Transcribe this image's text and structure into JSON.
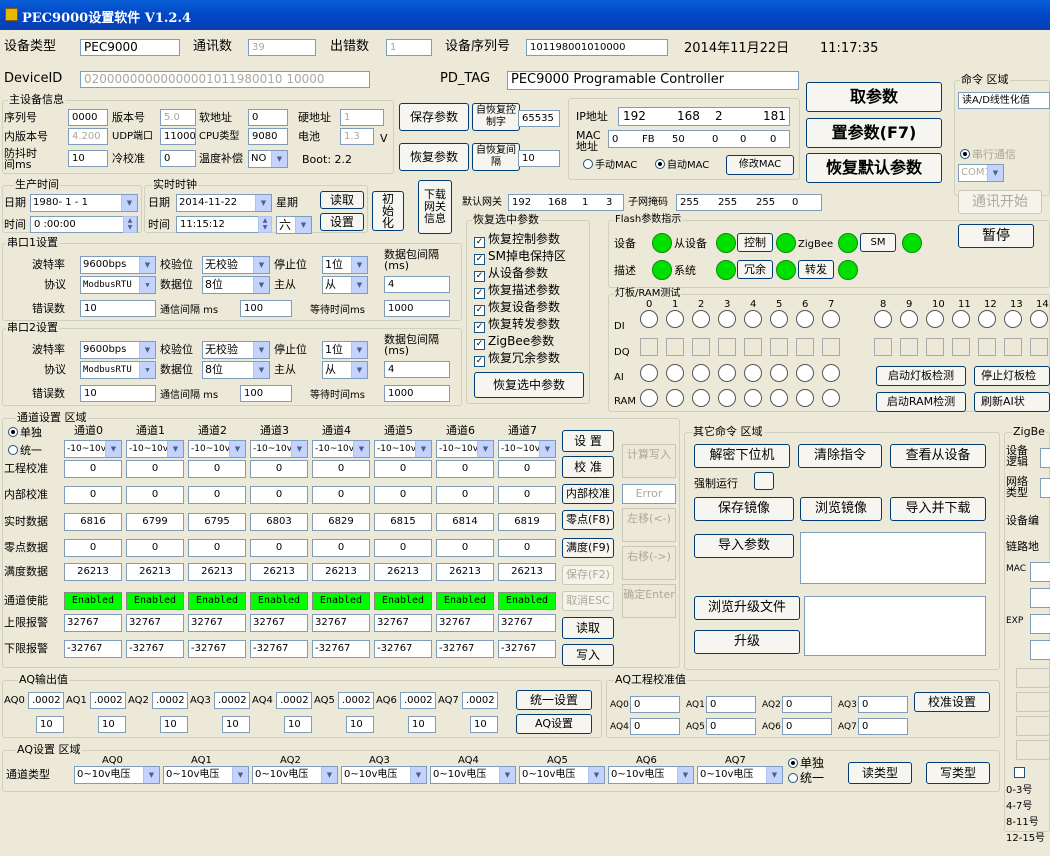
{
  "title": "PEC9000设置软件 V1.2.4",
  "top": {
    "devtype_label": "设备类型",
    "devtype": "PEC9000",
    "comm_label": "通讯数",
    "comm": "39",
    "err_label": "出错数",
    "err": "1",
    "serial_label": "设备序列号",
    "serial": "101198001010000",
    "date": "2014年11月22日",
    "time": "11:17:35",
    "devid_label": "DeviceID",
    "devid": "02000000000000001011980010 10000",
    "pdtag_label": "PD_TAG",
    "pdtag": "PEC9000 Programable Controller"
  },
  "master": {
    "title": "主设备信息",
    "seq_l": "序列号",
    "seq": "0000",
    "ver_l": "版本号",
    "ver": "5.0",
    "soft_l": "软地址",
    "soft": "0",
    "hard_l": "硬地址",
    "hard": "1",
    "inner_l": "内版本号",
    "inner": "4.200",
    "udp_l": "UDP端口",
    "udp": "11000",
    "cpu_l": "CPU类型",
    "cpu": "9080",
    "bat_l": "电池",
    "bat": "1.3",
    "v": "V",
    "shake_l": "防抖时间ms",
    "shake": "10",
    "cold_l": "冷校准",
    "cold": "0",
    "temp_l": "温度补偿",
    "temp": "NO",
    "boot": "Boot: 2.2"
  },
  "btns": {
    "save": "保存参数",
    "restore": "恢复参数",
    "auto_ctrl": "自恢复控制字",
    "auto_ctrl_v": "65535",
    "auto_int": "自恢复间隔",
    "auto_int_v": "10",
    "get": "取参数",
    "set": "置参数(F7)",
    "default": "恢复默认参数",
    "comm_start": "通讯开始",
    "pause": "暂停",
    "read": "读取",
    "setting": "设置",
    "init": "初始化",
    "gwinfo": "下载网关信息",
    "restore_sel": "恢复选中参数"
  },
  "ip": {
    "ip_l": "IP地址",
    "ip": [
      "192",
      "168",
      "2",
      "181"
    ],
    "mac_l": "MAC地址",
    "mac": [
      "0",
      "FB",
      "50",
      "0",
      "0",
      "0"
    ],
    "manual": "手动MAC",
    "auto": "自动MAC",
    "modmac": "修改MAC",
    "gw_l": "默认网关",
    "gw": [
      "192",
      "168",
      "1",
      "3"
    ],
    "mask_l": "子网掩码",
    "mask": [
      "255",
      "255",
      "255",
      "0"
    ]
  },
  "cmd": {
    "title": "命令 区域",
    "value": "读A/D线性化值",
    "serial": "串行通信",
    "com": "COM1"
  },
  "prod": {
    "title": "生产时间",
    "date_l": "日期",
    "date": "1980- 1 - 1",
    "time_l": "时间",
    "time": "0 :00:00"
  },
  "rtc": {
    "title": "实时时钟",
    "date_l": "日期",
    "date": "2014-11-22",
    "week_l": "星期",
    "week": "六",
    "time_l": "时间",
    "time": "11:15:12"
  },
  "com1": {
    "title": "串口1设置",
    "baud_l": "波特率",
    "baud": "9600bps",
    "parity_l": "校验位",
    "parity": "无校验",
    "stop_l": "停止位",
    "stop": "1位",
    "gap_l": "数据包间隔(ms)",
    "proto_l": "协议",
    "proto": "ModbusRTU",
    "data_l": "数据位",
    "data": "8位",
    "master_l": "主从",
    "master": "从",
    "gap": "4",
    "err_l": "错误数",
    "err": "10",
    "comm_l": "通信间隔 ms",
    "comm": "100",
    "wait_l": "等待时间ms",
    "wait": "1000"
  },
  "com2": {
    "title": "串口2设置",
    "baud_l": "波特率",
    "baud": "9600bps",
    "parity_l": "校验位",
    "parity": "无校验",
    "stop_l": "停止位",
    "stop": "1位",
    "gap_l": "数据包间隔(ms)",
    "proto_l": "协议",
    "proto": "ModbusRTU",
    "data_l": "数据位",
    "data": "8位",
    "master_l": "主从",
    "master": "从",
    "gap": "4",
    "err_l": "错误数",
    "err": "10",
    "comm_l": "通信间隔 ms",
    "comm": "100",
    "wait_l": "等待时间ms",
    "wait": "1000"
  },
  "restore": {
    "title": "恢复选中参数",
    "items": [
      "恢复控制参数",
      "SM掉电保持区",
      "从设备参数",
      "恢复描述参数",
      "恢复设备参数",
      "恢复转发参数",
      "ZigBee参数",
      "恢复冗余参数"
    ]
  },
  "flash": {
    "title": "Flash参数指示",
    "dev_l": "设备",
    "slave": "从设备",
    "ctrl": "控制",
    "zigbee": "ZigBee",
    "sm": "SM",
    "desc_l": "描述",
    "sys": "系统",
    "redun": "冗余",
    "fwd": "转发"
  },
  "lamp": {
    "title": "灯板/RAM测试",
    "di": "DI",
    "dq": "DQ",
    "ai": "AI",
    "ram": "RAM",
    "nums": [
      "0",
      "1",
      "2",
      "3",
      "4",
      "5",
      "6",
      "7",
      "8",
      "9",
      "10",
      "11",
      "12",
      "13",
      "14"
    ],
    "start_lamp": "启动灯板检测",
    "stop_lamp": "停止灯板检",
    "start_ram": "启动RAM检测",
    "refresh_ai": "刷新AI状"
  },
  "chan": {
    "title": "通道设置 区域",
    "single": "单独",
    "unify": "统一",
    "names": [
      "通道0",
      "通道1",
      "通道2",
      "通道3",
      "通道4",
      "通道5",
      "通道6",
      "通道7"
    ],
    "range": "-10~10v",
    "rows": [
      "工程校准",
      "内部校准",
      "实时数据",
      "零点数据",
      "满度数据",
      "通道使能",
      "上限报警",
      "下限报警"
    ],
    "eng": [
      "0",
      "0",
      "0",
      "0",
      "0",
      "0",
      "0",
      "0"
    ],
    "inner": [
      "0",
      "0",
      "0",
      "0",
      "0",
      "0",
      "0",
      "0"
    ],
    "rt": [
      "6816",
      "6799",
      "6795",
      "6803",
      "6829",
      "6815",
      "6814",
      "6819"
    ],
    "zero": [
      "0",
      "0",
      "0",
      "0",
      "0",
      "0",
      "0",
      "0"
    ],
    "full": [
      "26213",
      "26213",
      "26213",
      "26213",
      "26213",
      "26213",
      "26213",
      "26213"
    ],
    "en": "Enabled",
    "hi": "32767",
    "lo": "-32767"
  },
  "chbtns": {
    "set": "设 置",
    "calib": "校 准",
    "inner": "内部校准",
    "zero": "零点(F8)",
    "full": "满度(F9)",
    "save": "保存(F2)",
    "cancel": "取消ESC",
    "read": "读取",
    "write": "写入",
    "calc": "计算写入",
    "err": "Error",
    "left": "左移(<-)",
    "right": "右移(->)",
    "ok": "确定Enter"
  },
  "other": {
    "title": "其它命令 区域",
    "unlock": "解密下位机",
    "clear": "清除指令",
    "view": "查看从设备",
    "force": "强制运行",
    "save_img": "保存镜像",
    "browse_img": "浏览镜像",
    "import_dl": "导入并下载",
    "import_param": "导入参数",
    "browse_up": "浏览升级文件",
    "upgrade": "升级"
  },
  "zig": {
    "title": "ZigBe",
    "dev": "设备逻辑",
    "net": "网络类型",
    "code": "设备编",
    "link": "链路地",
    "mac": "MAC",
    "exp": "EXP",
    "rows": [
      "0-3号",
      "4-7号",
      "8-11号",
      "12-15号"
    ]
  },
  "aq": {
    "title": "AQ输出值",
    "labels": [
      "AQ0",
      "AQ1",
      "AQ2",
      "AQ3",
      "AQ4",
      "AQ5",
      "AQ6",
      "AQ7"
    ],
    "vals": [
      ".0002",
      ".0002",
      ".0002",
      ".0002",
      ".0002",
      ".0002",
      ".0002",
      ".0002"
    ],
    "set": [
      "10",
      "10",
      "10",
      "10",
      "10",
      "10",
      "10",
      "10"
    ],
    "unify": "统一设置",
    "aqset": "AQ设置"
  },
  "aqcal": {
    "title": "AQ工程校准值",
    "labels": [
      "AQ0",
      "AQ1",
      "AQ2",
      "AQ3",
      "AQ4",
      "AQ5",
      "AQ6",
      "AQ7"
    ],
    "vals": [
      "0",
      "0",
      "0",
      "0",
      "0",
      "0",
      "0",
      "0"
    ],
    "btn": "校准设置"
  },
  "aqcfg": {
    "title": "AQ设置 区域",
    "type_l": "通道类型",
    "labels": [
      "AQ0",
      "AQ1",
      "AQ2",
      "AQ3",
      "AQ4",
      "AQ5",
      "AQ6",
      "AQ7"
    ],
    "type": "0~10v电压",
    "single": "单独",
    "unify": "统一",
    "read": "读类型",
    "write": "写类型"
  }
}
